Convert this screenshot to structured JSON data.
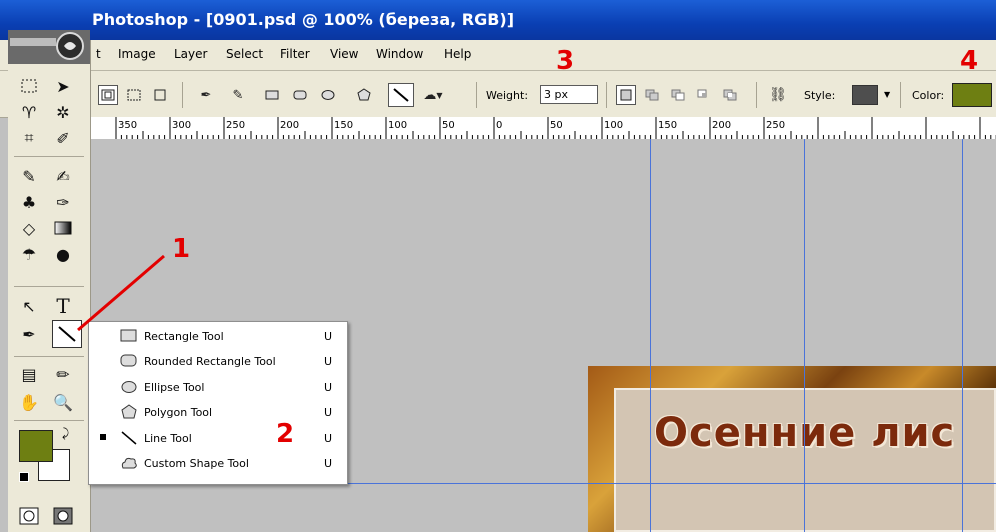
{
  "window": {
    "title": "Photoshop - [0901.psd @ 100% (береза, RGB)]"
  },
  "menu": [
    "t",
    "Image",
    "Layer",
    "Select",
    "Filter",
    "View",
    "Window",
    "Help"
  ],
  "options_bar": {
    "weight_label": "Weight:",
    "weight_value": "3 px",
    "style_label": "Style:",
    "color_label": "Color:",
    "style_color": "#4e4e4e",
    "shape_color": "#6e7f12"
  },
  "ruler": {
    "labels": [
      "350",
      "300",
      "250",
      "200",
      "150",
      "100",
      "50",
      "0",
      "50",
      "100",
      "150",
      "200",
      "250"
    ]
  },
  "flyout": {
    "items": [
      {
        "label": "Rectangle Tool",
        "shortcut": "U",
        "icon": "rectangle-icon",
        "selected": false
      },
      {
        "label": "Rounded Rectangle Tool",
        "shortcut": "U",
        "icon": "rounded-rectangle-icon",
        "selected": false
      },
      {
        "label": "Ellipse Tool",
        "shortcut": "U",
        "icon": "ellipse-icon",
        "selected": false
      },
      {
        "label": "Polygon Tool",
        "shortcut": "U",
        "icon": "polygon-icon",
        "selected": false
      },
      {
        "label": "Line Tool",
        "shortcut": "U",
        "icon": "line-icon",
        "selected": true
      },
      {
        "label": "Custom Shape Tool",
        "shortcut": "U",
        "icon": "custom-shape-icon",
        "selected": false
      }
    ]
  },
  "callouts": [
    "1",
    "2",
    "3",
    "4"
  ],
  "document": {
    "heading": "Осенние лис"
  },
  "colors": {
    "foreground": "#6e7f12",
    "background": "#ffffff",
    "guides": "#4a73d9",
    "callout": "#e30000"
  }
}
